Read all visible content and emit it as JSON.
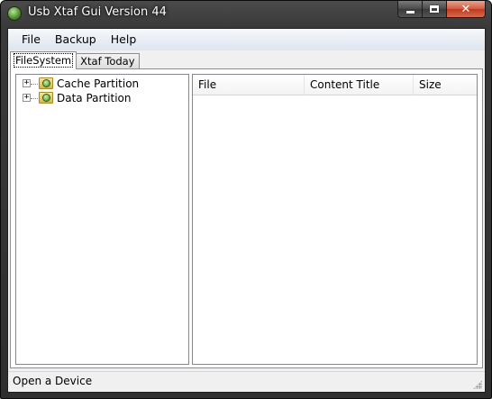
{
  "window": {
    "title": "Usb Xtaf Gui Version 44"
  },
  "menu": {
    "items": [
      "File",
      "Backup",
      "Help"
    ]
  },
  "tabs": [
    {
      "label": "FileSystem",
      "active": true
    },
    {
      "label": "Xtaf Today",
      "active": false
    }
  ],
  "tree": {
    "nodes": [
      {
        "label": "Cache Partition",
        "expander": "+",
        "icon": "partition-folder-icon"
      },
      {
        "label": "Data Partition",
        "expander": "+",
        "icon": "partition-folder-icon"
      }
    ]
  },
  "list": {
    "columns": [
      "File",
      "Content Title",
      "Size"
    ]
  },
  "status": {
    "text": "Open a Device"
  },
  "colors": {
    "close_button": "#c7472b",
    "frame": "#3a3a3a"
  }
}
